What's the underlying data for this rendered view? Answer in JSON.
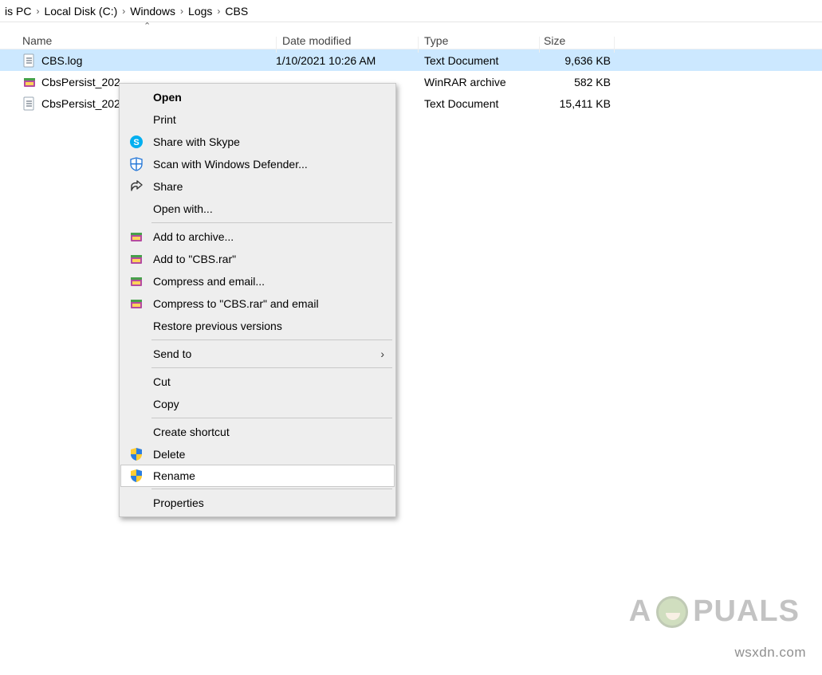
{
  "breadcrumb": [
    "is PC",
    "Local Disk (C:)",
    "Windows",
    "Logs",
    "CBS"
  ],
  "columns": {
    "name": "Name",
    "date": "Date modified",
    "type": "Type",
    "size": "Size"
  },
  "rows": [
    {
      "icon": "txt",
      "name": "CBS.log",
      "date": "1/10/2021 10:26 AM",
      "type": "Text Document",
      "size": "9,636 KB",
      "selected": true
    },
    {
      "icon": "rar",
      "name": "CbsPersist_202",
      "date": "",
      "type": "WinRAR archive",
      "size": "582 KB",
      "selected": false
    },
    {
      "icon": "txt",
      "name": "CbsPersist_202",
      "date": "",
      "type": "Text Document",
      "size": "15,411 KB",
      "selected": false
    }
  ],
  "context_menu": {
    "groups": [
      [
        {
          "label": "Open",
          "default": true
        },
        {
          "label": "Print"
        },
        {
          "label": "Share with Skype",
          "icon": "skype"
        },
        {
          "label": "Scan with Windows Defender...",
          "icon": "defender"
        },
        {
          "label": "Share",
          "icon": "share"
        },
        {
          "label": "Open with..."
        }
      ],
      [
        {
          "label": "Add to archive...",
          "icon": "winrar"
        },
        {
          "label": "Add to \"CBS.rar\"",
          "icon": "winrar"
        },
        {
          "label": "Compress and email...",
          "icon": "winrar"
        },
        {
          "label": "Compress to \"CBS.rar\" and email",
          "icon": "winrar"
        },
        {
          "label": "Restore previous versions"
        }
      ],
      [
        {
          "label": "Send to",
          "submenu": true
        }
      ],
      [
        {
          "label": "Cut"
        },
        {
          "label": "Copy"
        }
      ],
      [
        {
          "label": "Create shortcut"
        },
        {
          "label": "Delete",
          "icon": "shield"
        },
        {
          "label": "Rename",
          "icon": "shield",
          "hover": true
        }
      ],
      [
        {
          "label": "Properties"
        }
      ]
    ]
  },
  "watermark": {
    "prefix": "A",
    "suffix": "PUALS"
  },
  "footer_url": "wsxdn.com"
}
